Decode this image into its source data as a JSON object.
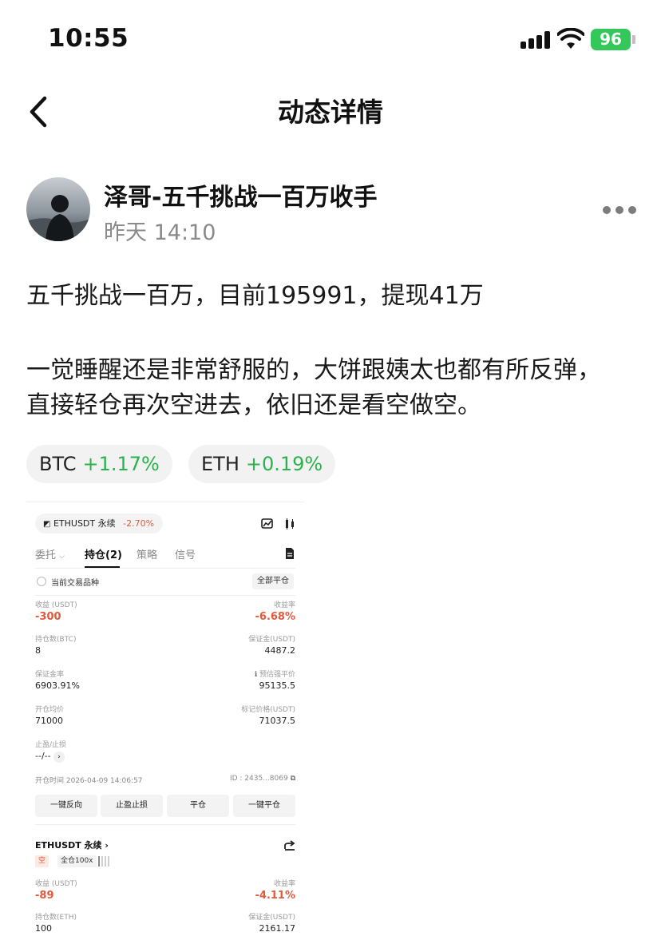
{
  "status_bar": {
    "time": "10:55",
    "battery": "96"
  },
  "nav": {
    "title": "动态详情"
  },
  "author": {
    "name": "泽哥-五千挑战一百万收手",
    "time": "昨天 14:10"
  },
  "post": {
    "line1": "五千挑战一百万，目前195991，提现41万",
    "paragraph2": "一觉睡醒还是非常舒服的，大饼跟姨太也都有所反弹，直接轻仓再次空进去，依旧还是看空做空。"
  },
  "tags": [
    {
      "symbol": "BTC",
      "change": "+1.17%"
    },
    {
      "symbol": "ETH",
      "change": "+0.19%"
    }
  ],
  "colors": {
    "positive": "#2bb24c",
    "negative": "#e05a3c",
    "battery": "#34c759"
  },
  "screenshot": {
    "symbol": "ETHUSDT 永续",
    "symbol_change": "-2.70%",
    "tabs": [
      "委托",
      "持仓(2)",
      "策略",
      "信号"
    ],
    "active_tab": "持仓(2)",
    "current_pair_label": "当前交易品种",
    "close_all_label": "全部平仓",
    "position1": {
      "pnl_label": "收益 (USDT)",
      "pnl_value": "-300",
      "roe_label": "收益率",
      "roe_value": "-6.68%",
      "size_label": "持仓数(BTC)",
      "size_value": "8",
      "margin_label": "保证金(USDT)",
      "margin_value": "4487.2",
      "margin_ratio_label": "保证金率",
      "margin_ratio_value": "6903.91%",
      "liq_label": "预估强平价",
      "liq_value": "95135.5",
      "entry_label": "开仓均价",
      "entry_value": "71000",
      "mark_label": "标记价格(USDT)",
      "mark_value": "71037.5",
      "tpsl_label": "止盈/止损",
      "tpsl_value": "--/--",
      "open_time": "开仓时间 2026-04-09 14:06:57",
      "id": "ID : 2435...8069"
    },
    "actions": [
      "一键反向",
      "止盈止损",
      "平仓",
      "一键平仓"
    ],
    "position2": {
      "symbol": "ETHUSDT 永续",
      "side": "空",
      "leverage": "全仓100x",
      "pnl_label": "收益 (USDT)",
      "pnl_value": "-89",
      "roe_label": "收益率",
      "roe_value": "-4.11%",
      "size_label": "持仓数(ETH)",
      "size_value": "100",
      "margin_label": "保证金(USDT)",
      "margin_value": "2161.17"
    }
  }
}
